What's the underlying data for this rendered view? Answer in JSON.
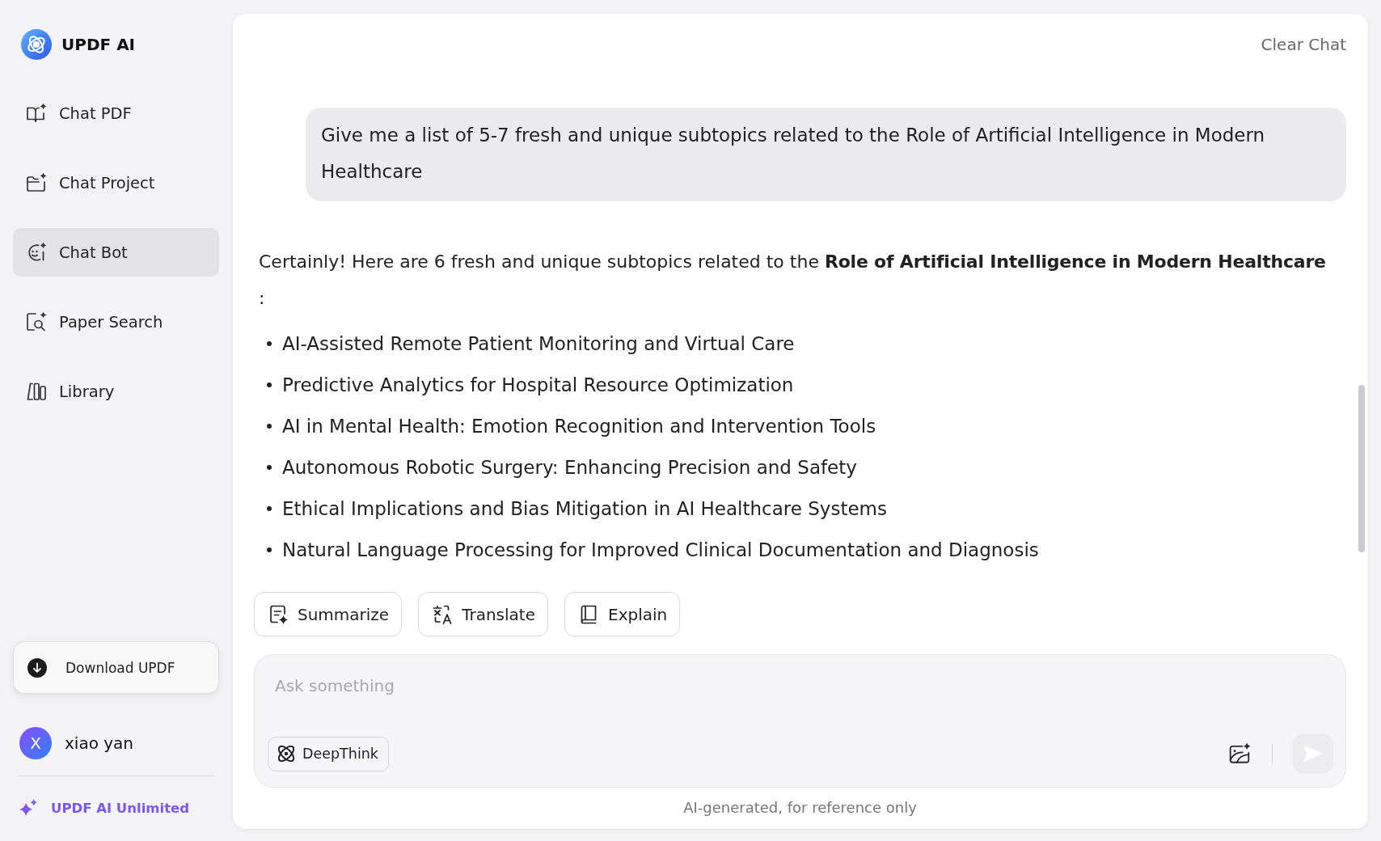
{
  "sidebar": {
    "logo": {
      "title": "UPDF AI"
    },
    "items": [
      {
        "kind": "pdf",
        "label": "Chat PDF",
        "selected": false
      },
      {
        "kind": "project",
        "label": "Chat Project",
        "selected": false
      },
      {
        "kind": "bot",
        "label": "Chat Bot",
        "selected": true
      },
      {
        "kind": "paper",
        "label": "Paper Search",
        "selected": false
      },
      {
        "kind": "library",
        "label": "Library",
        "selected": false
      }
    ],
    "download_button": {
      "label": "Download UPDF"
    },
    "user": {
      "initial": "X",
      "name": "xiao yan"
    },
    "upgrade_link": {
      "label": "UPDF AI Unlimited"
    }
  },
  "chat": {
    "clear_button": {
      "label": "Clear Chat"
    },
    "user_message": {
      "text": "Give me a list of 5-7 fresh and unique subtopics related to the Role of Artificial Intelligence in Modern Healthcare"
    },
    "response": {
      "intro": "Certainly! Here are 6 fresh and unique subtopics related to the **Role of Artificial Intelligence in Modern Healthcare** :",
      "bullets": [
        "AI-Assisted Remote Patient Monitoring and Virtual Care",
        "Predictive Analytics for Hospital Resource Optimization",
        "AI in Mental Health: Emotion Recognition and Intervention Tools",
        "Autonomous Robotic Surgery: Enhancing Precision and Safety",
        "Ethical Implications and Bias Mitigation in AI Healthcare Systems",
        "Natural Language Processing for Improved Clinical Documentation and Diagnosis"
      ]
    },
    "actions": [
      {
        "kind": "summarize",
        "label": "Summarize"
      },
      {
        "kind": "translate",
        "label": "Translate"
      },
      {
        "kind": "explain",
        "label": "Explain"
      }
    ],
    "composer": {
      "placeholder": "Ask something",
      "deepthink_button": {
        "label": "DeepThink"
      },
      "send_button": {
        "disabled": true
      }
    },
    "disclaimer": "AI-generated, for reference only"
  }
}
